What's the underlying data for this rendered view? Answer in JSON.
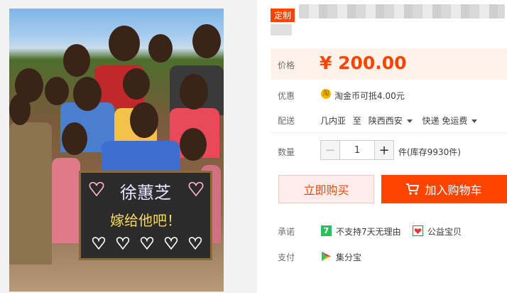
{
  "tag": "定制",
  "price": {
    "label": "价格",
    "value": "¥ 200.00"
  },
  "discount": {
    "label": "优惠",
    "text": "淘金币可抵4.00元",
    "icon": "coin-icon",
    "icon_glyph": "淘"
  },
  "delivery": {
    "label": "配送",
    "from": "几内亚",
    "to_word": "至",
    "to": "陕西西安",
    "method": "快递 免运费"
  },
  "quantity": {
    "label": "数量",
    "minus": "−",
    "value": "1",
    "plus": "+",
    "stock": "件(库存9930件)"
  },
  "buttons": {
    "buy_now": "立即购买",
    "add_cart": "加入购物车"
  },
  "promise": {
    "label": "承诺",
    "items": [
      {
        "icon_glyph": "7",
        "text": "不支持7天无理由"
      },
      {
        "text": "公益宝贝"
      }
    ]
  },
  "payment": {
    "label": "支付",
    "method": "集分宝"
  },
  "photo": {
    "board_line1": "徐蕙芝",
    "board_line2": "嫁给他吧！"
  },
  "colors": {
    "accent": "#ff4400",
    "price_bg": "#fff2e8",
    "promise_green": "#2dbe60",
    "charity_red": "#e4393c"
  }
}
